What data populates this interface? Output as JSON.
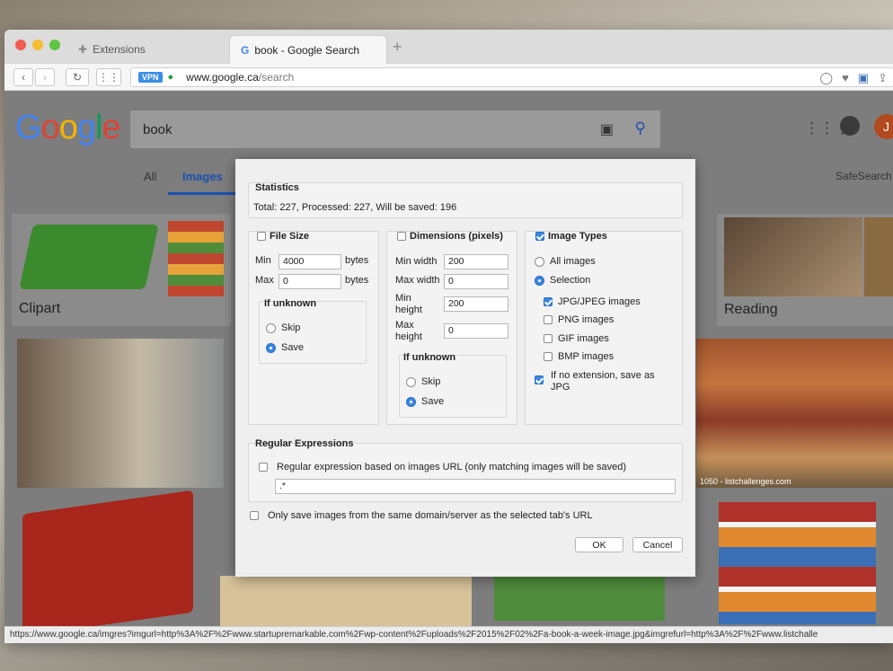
{
  "tabs": [
    {
      "label": "Extensions",
      "icon": "puzzle-icon"
    },
    {
      "label": "book - Google Search",
      "icon": "google-g-icon"
    }
  ],
  "address": {
    "vpn": "VPN",
    "host": "www.google.ca",
    "path": "/search"
  },
  "search": {
    "logo": "Google",
    "query": "book",
    "avatar_letter": "J"
  },
  "page_tabs": {
    "all": "All",
    "images": "Images",
    "safesearch": "SafeSearch"
  },
  "tiles": {
    "clipart": "Clipart",
    "reading": "Reading",
    "caption": "1050 - listchallenges.com"
  },
  "status_url": "https://www.google.ca/imgres?imgurl=http%3A%2F%2Fwww.startupremarkable.com%2Fwp-content%2Fuploads%2F2015%2F02%2Fa-book-a-week-image.jpg&imgrefurl=http%3A%2F%2Fwww.listchalle",
  "dialog": {
    "statistics": {
      "title": "Statistics",
      "text": "Total: 227, Processed: 227, Will be saved: 196"
    },
    "file_size": {
      "title": "File Size",
      "checked": false,
      "min_label": "Min",
      "min_value": "4000",
      "min_unit": "bytes",
      "max_label": "Max",
      "max_value": "0",
      "max_unit": "bytes",
      "unknown_title": "If unknown",
      "skip": "Skip",
      "save": "Save"
    },
    "dimensions": {
      "title": "Dimensions (pixels)",
      "checked": false,
      "min_width_label": "Min width",
      "min_width": "200",
      "max_width_label": "Max width",
      "max_width": "0",
      "min_height_label_1": "Min",
      "min_height_label_2": "height",
      "min_height": "200",
      "max_height_label_1": "Max",
      "max_height_label_2": "height",
      "max_height": "0",
      "unknown_title": "If unknown",
      "skip": "Skip",
      "save": "Save"
    },
    "image_types": {
      "title": "Image Types",
      "checked": true,
      "all_images": "All images",
      "selection": "Selection",
      "jpg": "JPG/JPEG images",
      "png": "PNG images",
      "gif": "GIF images",
      "bmp": "BMP images",
      "no_ext_1": "If no extension, save as",
      "no_ext_2": "JPG"
    },
    "regex": {
      "title": "Regular Expressions",
      "label": "Regular expression based on images URL (only matching images will be saved)",
      "value": ".*"
    },
    "same_domain": "Only save images from the same domain/server as the selected tab's URL",
    "ok": "OK",
    "cancel": "Cancel"
  }
}
